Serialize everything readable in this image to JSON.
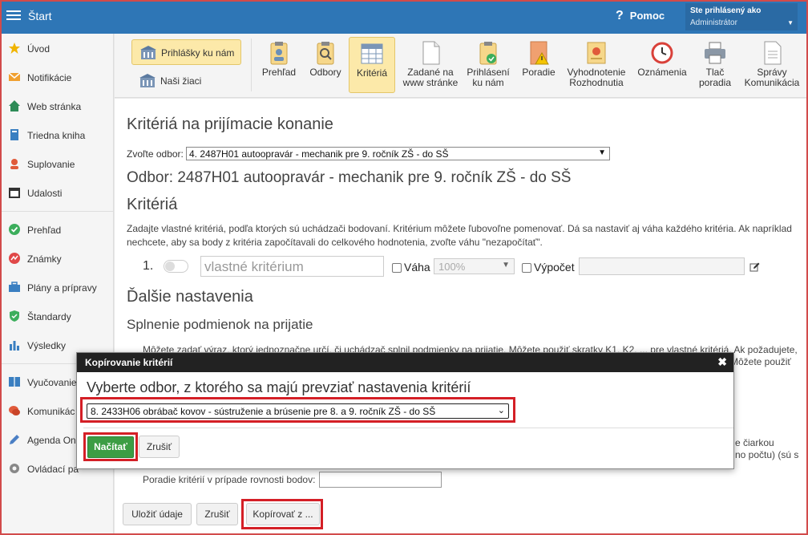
{
  "topbar": {
    "title": "Štart",
    "help_label": "Pomoc",
    "user_line1": "Ste prihlásený ako",
    "user_line2": "Administrátor"
  },
  "sidebar": {
    "items": [
      {
        "label": "Úvod",
        "icon": "star-icon"
      },
      {
        "label": "Notifikácie",
        "icon": "envelope-icon"
      },
      {
        "label": "Web stránka",
        "icon": "home-icon"
      },
      {
        "label": "Triedna kniha",
        "icon": "book-icon"
      },
      {
        "label": "Suplovanie",
        "icon": "person-icon"
      },
      {
        "label": "Udalosti",
        "icon": "calendar-icon"
      },
      {
        "label": "Prehľad",
        "icon": "check-circle-icon"
      },
      {
        "label": "Známky",
        "icon": "grades-icon"
      },
      {
        "label": "Plány a prípravy",
        "icon": "briefcase-icon"
      },
      {
        "label": "Štandardy",
        "icon": "shield-icon"
      },
      {
        "label": "Výsledky",
        "icon": "bar-chart-icon"
      },
      {
        "label": "Vyučovanie",
        "icon": "open-book-icon"
      },
      {
        "label": "Komunikác",
        "icon": "chat-icon"
      },
      {
        "label": "Agenda On",
        "icon": "pencil-icon"
      },
      {
        "label": "Ovládací pa",
        "icon": "gear-icon"
      }
    ]
  },
  "toolbar": {
    "left_buttons": [
      {
        "label": "Prihlášky ku nám",
        "icon": "building-icon"
      },
      {
        "label": "Naši žiaci",
        "icon": "building-icon"
      }
    ],
    "items": [
      {
        "label": "Prehľad",
        "icon": "clipboard-person-icon"
      },
      {
        "label": "Odbory",
        "icon": "clipboard-search-icon"
      },
      {
        "label": "Kritériá",
        "icon": "table-icon"
      },
      {
        "label": "Zadané na www stránke",
        "icon": "document-icon"
      },
      {
        "label": "Prihlásení ku nám",
        "icon": "clipboard-check-icon"
      },
      {
        "label": "Poradie",
        "icon": "warning-document-icon"
      },
      {
        "label": "Vyhodnotenie Rozhodnutia",
        "icon": "certificate-icon"
      },
      {
        "label": "Oznámenia",
        "icon": "clock-icon"
      },
      {
        "label": "Tlač poradia",
        "icon": "printer-icon"
      },
      {
        "label": "Správy Komunikácia",
        "icon": "document-lines-icon"
      }
    ]
  },
  "content": {
    "heading": "Kritériá na prijímacie konanie",
    "odbor_label": "Zvoľte odbor:",
    "odbor_selected": "4. 2487H01 autoopravár - mechanik pre 9. ročník ZŠ - do SŠ",
    "odbor_heading": "Odbor: 2487H01 autoopravár - mechanik pre 9. ročník ZŠ - do SŠ",
    "kriteria_heading": "Kritériá",
    "kriteria_text": "Zadajte vlastné kritériá, podľa ktorých sú uchádzači bodovaní. Kritérium môžete ľubovoľne pomenovať. Dá sa nastaviť aj váha každého kritéria. Ak napríklad nechcete, aby sa body z kritéria započítavali do celkového hodnotenia, zvoľte váhu \"nezapočítať\".",
    "criterion": {
      "number": "1.",
      "name_placeholder": "vlastné kritérium",
      "vaha_label": "Váha",
      "vaha_value": "100%",
      "vypocet_label": "Výpočet"
    },
    "dalsie_heading": "Ďalšie nastavenia",
    "splnenie_heading": "Splnenie podmienok na prijatie",
    "splnenie_text_line1": "Môžete zadať výraz, ktorý jednoznačne určí, či uchádzač splnil podmienky na prijatie. Môžete použiť skratky K1, K2, ... pre vlastné kritériá. Ak požadujete,",
    "splnenie_text_line2": "Môžete použiť",
    "right_text_1": "e čiarkou",
    "right_text_2": "no počtu) (sú s",
    "poradie_label": "Poradie kritérií v prípade rovnosti bodov:",
    "buttons": {
      "save": "Uložiť údaje",
      "cancel": "Zrušiť",
      "copy": "Kopírovať z ..."
    }
  },
  "modal": {
    "header": "Kopírovanie kritérií",
    "close_glyph": "✖",
    "title": "Vyberte odbor, z ktorého sa majú prevziať nastavenia kritérií",
    "selected": "8. 2433H06 obrábač kovov - sústruženie a brúsenie pre 8. a 9. ročník ZŠ - do SŠ",
    "load_label": "Načítať",
    "cancel_label": "Zrušiť"
  },
  "colors": {
    "topbar": "#2e76b6",
    "highlight": "#d41f26",
    "primary_button": "#3c9d44",
    "active_tool": "#fce9a9"
  }
}
